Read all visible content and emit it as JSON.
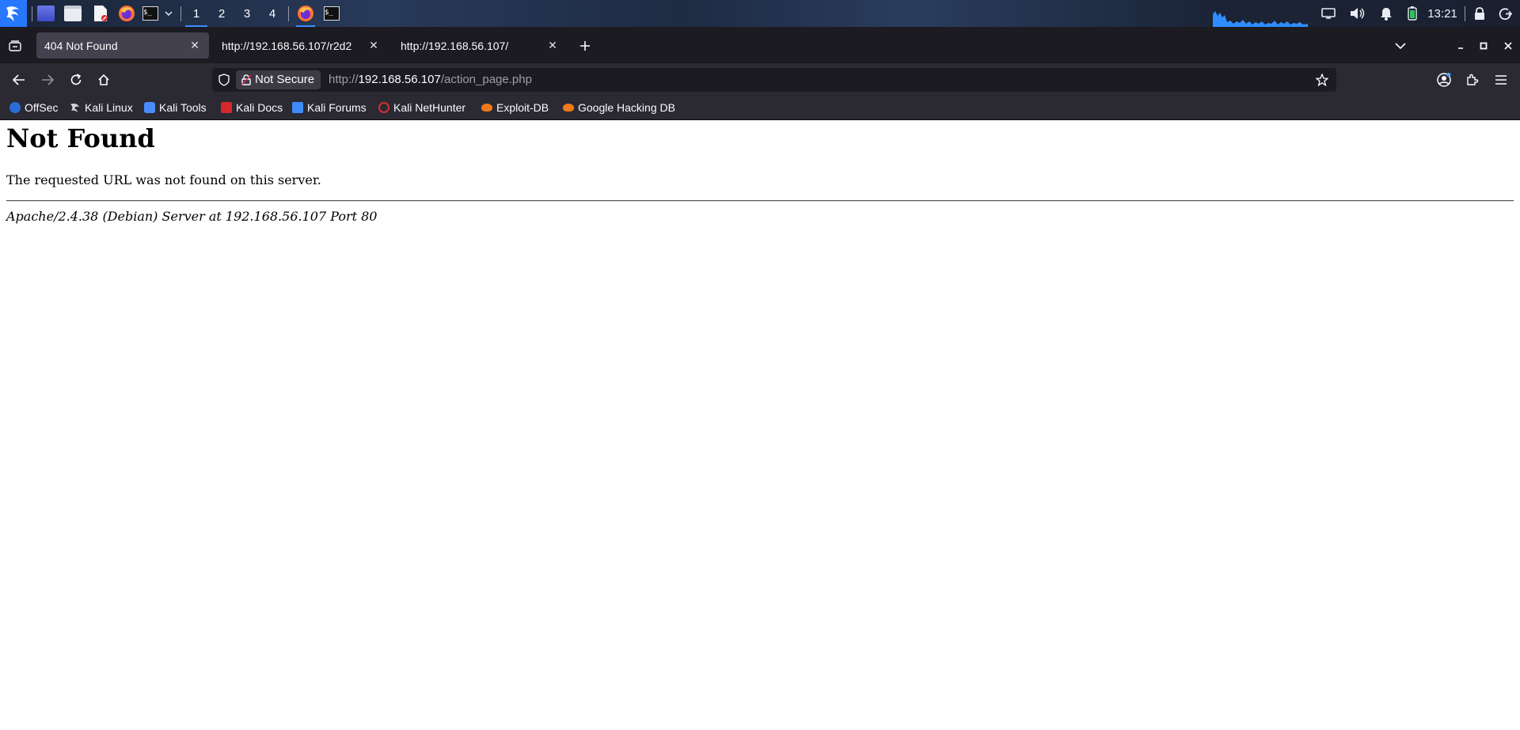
{
  "taskbar": {
    "workspaces": [
      "1",
      "2",
      "3",
      "4"
    ],
    "active_workspace": "1",
    "clock": "13:21",
    "accent": "#3b8cff",
    "app_icons": [
      "kali-menu-icon",
      "desktop-icon",
      "file-manager-icon",
      "text-editor-icon",
      "firefox-icon",
      "terminal-icon",
      "chevron-down-icon"
    ]
  },
  "browser": {
    "tabs": [
      {
        "title": "404 Not Found",
        "active": true
      },
      {
        "title": "http://192.168.56.107/r2d2",
        "active": false
      },
      {
        "title": "http://192.168.56.107/",
        "active": false
      }
    ],
    "security_label": "Not Secure",
    "url": {
      "scheme": "http://",
      "host": "192.168.56.107",
      "path": "/action_page.php"
    },
    "bookmarks": [
      {
        "label": "OffSec",
        "color": "#2b6cd8"
      },
      {
        "label": "Kali Linux",
        "color": "#cfd3da"
      },
      {
        "label": "Kali Tools",
        "color": "#4a8cff"
      },
      {
        "label": "Kali Docs",
        "color": "#d6272b"
      },
      {
        "label": "Kali Forums",
        "color": "#3d8bff"
      },
      {
        "label": "Kali NetHunter",
        "color": "#d32f2f"
      },
      {
        "label": "Exploit-DB",
        "color": "#f07a1a"
      },
      {
        "label": "Google Hacking DB",
        "color": "#f07a1a"
      }
    ]
  },
  "page": {
    "heading": "Not Found",
    "message": "The requested URL was not found on this server.",
    "server_signature": "Apache/2.4.38 (Debian) Server at 192.168.56.107 Port 80"
  }
}
